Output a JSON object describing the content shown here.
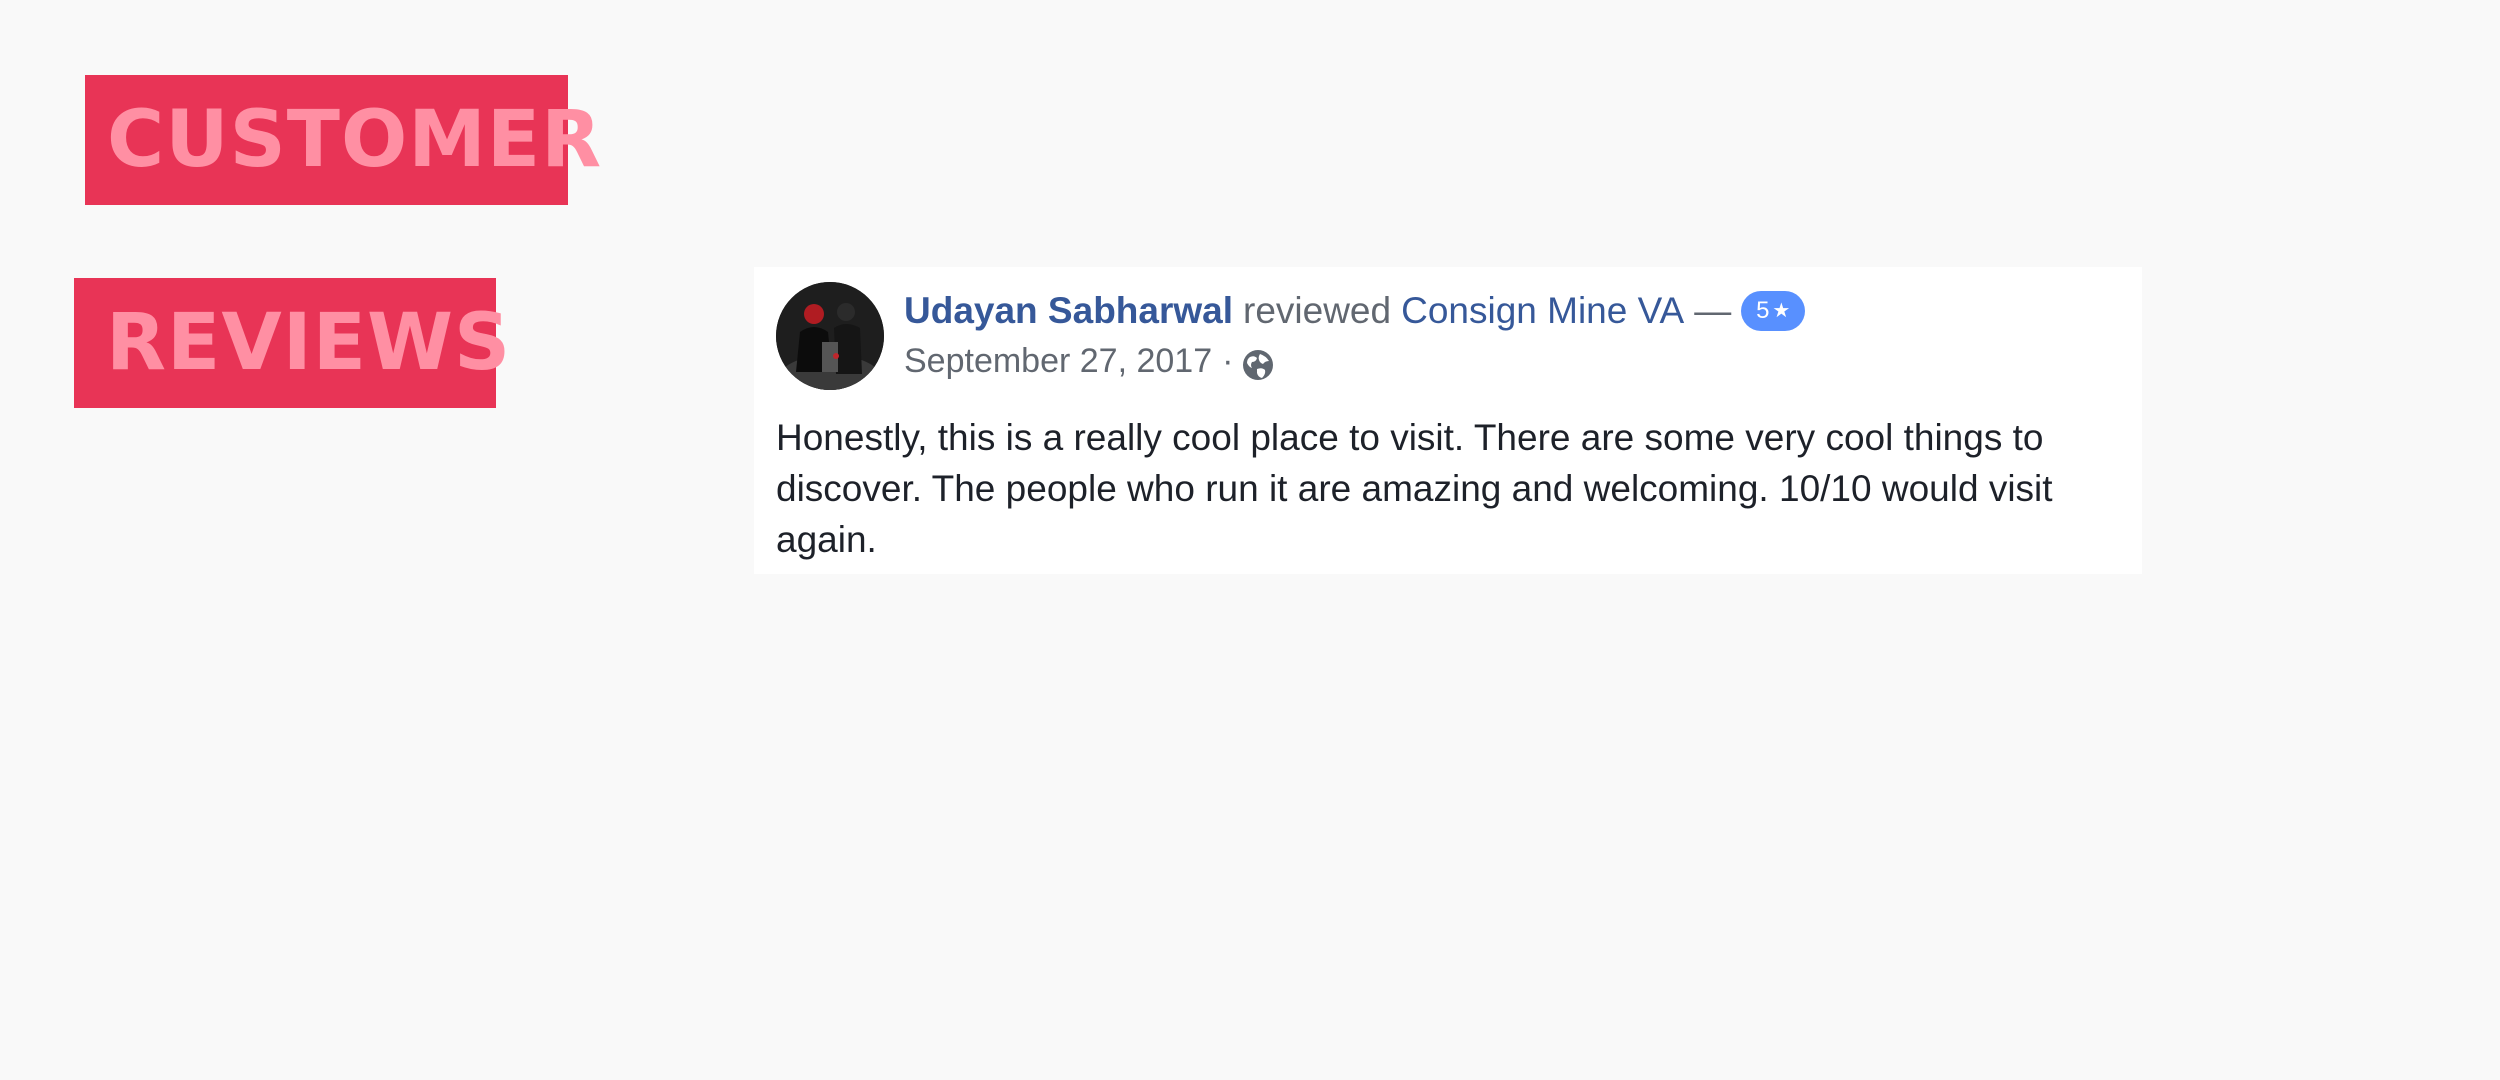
{
  "banner": {
    "line1": "CUSTOMER",
    "line2": "REVIEWS",
    "background_color": "#e83456",
    "text_color": "#ff8fa3"
  },
  "review": {
    "author": "Udayan Sabharwal",
    "verb": "reviewed",
    "page_name": "Consign Mine VA",
    "dash": "—",
    "rating": "5",
    "rating_icon": "star-icon",
    "date": "September 27, 2017",
    "separator": "·",
    "privacy_icon": "globe-icon",
    "text": "Honestly, this is a really cool place to visit. There are some very cool things to discover. The people who run it are amazing and welcoming. 10/10 would visit again.",
    "link_color": "#365899",
    "badge_color": "#5890ff"
  }
}
